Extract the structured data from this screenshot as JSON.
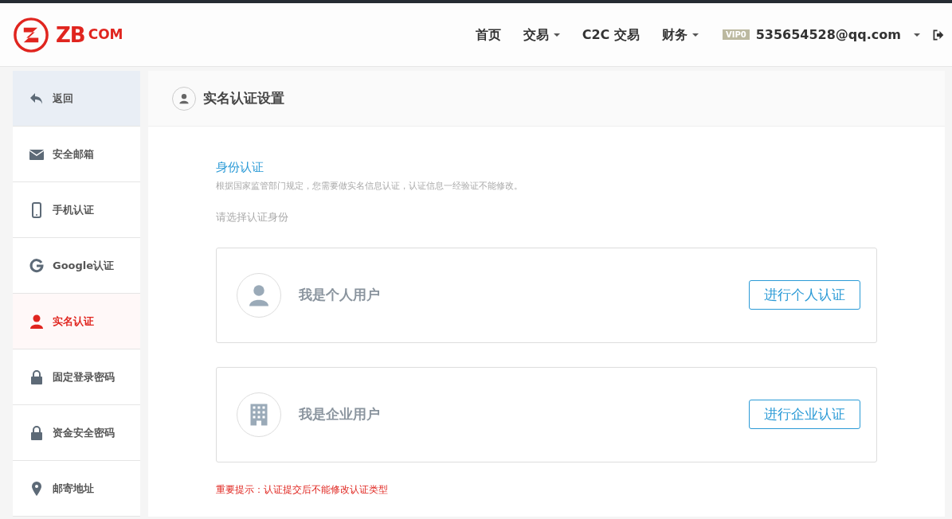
{
  "logo": {
    "main": "ZB",
    "sub": "COM"
  },
  "nav": [
    {
      "label": "首页",
      "kind": "link"
    },
    {
      "label": "交易",
      "kind": "dropdown"
    },
    {
      "label": "C2C 交易",
      "kind": "link"
    },
    {
      "label": "财务",
      "kind": "dropdown"
    }
  ],
  "user": {
    "vip": "VIP0",
    "email": "535654528@qq.com"
  },
  "sidebar": {
    "items": [
      {
        "label": "返回",
        "kind": "back",
        "selected": false
      },
      {
        "label": "安全邮箱",
        "kind": "mail",
        "selected": false
      },
      {
        "label": "手机认证",
        "kind": "phone",
        "selected": false
      },
      {
        "label": "Google认证",
        "kind": "google",
        "selected": false
      },
      {
        "label": "实名认证",
        "kind": "user",
        "selected": true
      },
      {
        "label": "固定登录密码",
        "kind": "lock",
        "selected": false
      },
      {
        "label": "资金安全密码",
        "kind": "lock",
        "selected": false
      },
      {
        "label": "邮寄地址",
        "kind": "pin",
        "selected": false
      }
    ]
  },
  "panel": {
    "title": "实名认证设置",
    "section_title": "身份认证",
    "description": "根据国家监管部门规定，您需要做实名信息认证，认证信息一经验证不能修改。",
    "prompt": "请选择认证身份",
    "options": [
      {
        "kind": "user",
        "label": "我是个人用户",
        "button": "进行个人认证"
      },
      {
        "kind": "building",
        "label": "我是企业用户",
        "button": "进行企业认证"
      }
    ],
    "warning": "重要提示：认证提交后不能修改认证类型"
  }
}
